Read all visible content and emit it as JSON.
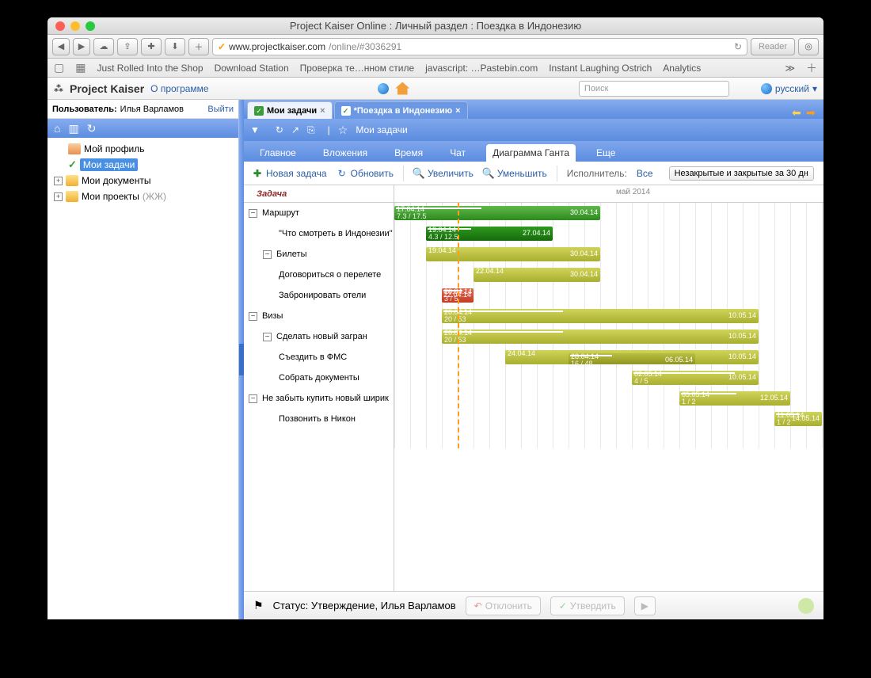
{
  "browser": {
    "title": "Project Kaiser Online : Личный раздел : Поездка в Индонезию",
    "url_host": "www.projectkaiser.com",
    "url_path": "/online/#3036291",
    "reader": "Reader",
    "bookmarks": [
      "Just Rolled Into the Shop",
      "Download Station",
      "Проверка те…нном стиле",
      "javascript: …Pastebin.com",
      "Instant Laughing Ostrich",
      "Analytics"
    ]
  },
  "app": {
    "brand": "Project Kaiser",
    "about": "О программе",
    "search_placeholder": "Поиск",
    "language": "русский"
  },
  "sidebar": {
    "user_label": "Пользователь:",
    "user_name": "Илья Варламов",
    "logout": "Выйти",
    "items": [
      {
        "label": "Мой профиль"
      },
      {
        "label": "Мои задачи"
      },
      {
        "label": "Мои документы"
      },
      {
        "label": "Мои проекты",
        "suffix": "(ЖЖ)"
      }
    ]
  },
  "tabs": {
    "t1": "Мои задачи",
    "t2": "*Поездка в Индонезию"
  },
  "toolbar": {
    "breadcrumb": "Мои задачи"
  },
  "subtabs": {
    "main": "Главное",
    "attachments": "Вложения",
    "time": "Время",
    "chat": "Чат",
    "gantt": "Диаграмма Ганта",
    "more": "Еще"
  },
  "gantt_toolbar": {
    "new_task": "Новая задача",
    "refresh": "Обновить",
    "zoom_in": "Увеличить",
    "zoom_out": "Уменьшить",
    "executor_label": "Исполнитель:",
    "executor_value": "Все",
    "filter": "Незакрытые и закрытые за 30 дн"
  },
  "gantt": {
    "header_task": "Задача",
    "month_label": "май 2014",
    "tasks": [
      {
        "name": "Маршрут",
        "level": 1,
        "toggle": "−"
      },
      {
        "name": "\"Что смотреть в Индонезии\"",
        "level": 3
      },
      {
        "name": "Билеты",
        "level": 2,
        "toggle": "−"
      },
      {
        "name": "Договориться о перелете",
        "level": 3
      },
      {
        "name": "Забронировать отели",
        "level": 3
      },
      {
        "name": "Визы",
        "level": 1,
        "toggle": "−"
      },
      {
        "name": "Сделать новый загран",
        "level": 2,
        "toggle": "−"
      },
      {
        "name": "Съездить в ФМС",
        "level": 3
      },
      {
        "name": "Собрать документы",
        "level": 3
      },
      {
        "name": "Не забыть купить новый ширик",
        "level": 1,
        "toggle": "−"
      },
      {
        "name": "Позвонить в Никон",
        "level": 3
      }
    ]
  },
  "statusbar": {
    "status": "Статус: Утверждение, Илья Варламов",
    "decline": "Отклонить",
    "approve": "Утвердить"
  },
  "chart_data": {
    "type": "gantt",
    "today": "21.04.14",
    "axis": {
      "start": "17.04.14",
      "end": "14.05.14",
      "month_marker": "май 2014"
    },
    "bars": [
      {
        "row": 0,
        "start": "17.04.14",
        "end": "30.04.14",
        "progress_label": "7.3 / 17.5",
        "color": "green"
      },
      {
        "row": 1,
        "start": "19.04.14",
        "end": "27.04.14",
        "progress_label": "4.3 / 12.5",
        "color": "dgreen"
      },
      {
        "row": 2,
        "start": "19.04.14",
        "end": "30.04.14",
        "color": "olive"
      },
      {
        "row": 3,
        "start": "22.04.14",
        "end": "30.04.14",
        "color": "olive"
      },
      {
        "row": 4,
        "start": "20.04.14",
        "end": "22.04.14",
        "progress_label": "3 / 5",
        "color": "red"
      },
      {
        "row": 5,
        "start": "20.04.14",
        "end": "10.05.14",
        "progress_label": "20 / 53",
        "color": "olive"
      },
      {
        "row": 6,
        "start": "20.04.14",
        "end": "10.05.14",
        "progress_label": "20 / 53",
        "color": "olive"
      },
      {
        "row": 7,
        "start": "24.04.14",
        "end": "10.05.14",
        "color": "olive"
      },
      {
        "row": 7,
        "start": "28.04.14",
        "end": "06.05.14",
        "progress_label": "16 / 48",
        "color": "oliveD",
        "sub": true
      },
      {
        "row": 8,
        "start": "02.05.14",
        "end": "10.05.14",
        "progress_label": "4 / 5",
        "color": "olive"
      },
      {
        "row": 9,
        "start": "05.05.14",
        "end": "12.05.14",
        "progress_label": "1 / 2",
        "color": "olive"
      },
      {
        "row": 10,
        "start": "11.05.14",
        "end": "14.05.14",
        "progress_label": "1 / 2",
        "color": "olive"
      }
    ]
  }
}
